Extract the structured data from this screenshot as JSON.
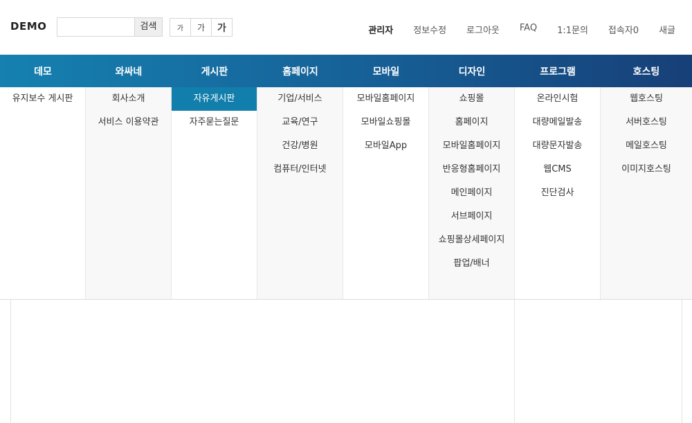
{
  "header": {
    "logo": "DEMO",
    "search": {
      "placeholder": "",
      "value": "",
      "button_label": "검색"
    },
    "font_sizes": [
      "가",
      "가",
      "가"
    ],
    "util_links": [
      "관리자",
      "정보수정",
      "로그아웃",
      "FAQ",
      "1:1문의",
      "접속자0",
      "새글"
    ]
  },
  "nav": {
    "items": [
      "데모",
      "와싸네",
      "게시판",
      "홈페이지",
      "모바일",
      "디자인",
      "프로그램",
      "호스팅"
    ]
  },
  "mega_menu": {
    "columns": [
      {
        "links": [
          "유지보수 게시판"
        ]
      },
      {
        "links": [
          "회사소개",
          "서비스 이용약관"
        ]
      },
      {
        "links": [
          "자유게시판",
          "자주묻는질문"
        ],
        "active": "자유게시판"
      },
      {
        "links": [
          "기업/서비스",
          "교육/연구",
          "건강/병원",
          "컴퓨터/인터넷"
        ]
      },
      {
        "links": [
          "모바일홈페이지",
          "모바일쇼핑몰",
          "모바일App"
        ]
      },
      {
        "links": [
          "쇼핑몰",
          "홈페이지",
          "모바일홈페이지",
          "반응형홈페이지",
          "메인페이지",
          "서브페이지",
          "쇼핑몰상세페이지",
          "팝업/배너"
        ]
      },
      {
        "links": [
          "온라인시험",
          "대량메일발송",
          "대량문자발송",
          "웹CMS",
          "진단검사"
        ]
      },
      {
        "links": [
          "웹호스팅",
          "서버호스팅",
          "메일호스팅",
          "이미지호스팅"
        ]
      }
    ]
  },
  "colors": {
    "nav_gradient_start": "#1581b0",
    "nav_gradient_end": "#173f77",
    "active_item": "#127eab"
  }
}
